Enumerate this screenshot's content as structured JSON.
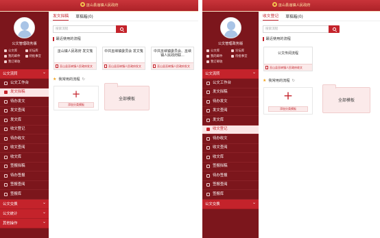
{
  "app_title": "巫山县庙镇人民政府",
  "user": {
    "name": "公文管理政务版"
  },
  "quick_links": [
    "公文库",
    "论坛库",
    "我的邮件",
    "待批事宜",
    "我订邮收"
  ],
  "left": {
    "section_main": "公文流转",
    "menu": [
      "公文工作台",
      "发文拟稿",
      "待办发文",
      "发文查阅",
      "发文库",
      "收文登记",
      "待办收文",
      "收文查阅",
      "收文库",
      "签报拟稿",
      "待办签报",
      "签报查阅",
      "签报库"
    ],
    "active_index": 1,
    "bottom_sections": [
      "公文交换",
      "公文统计",
      "其他操作"
    ],
    "tabs": [
      "发文拟稿",
      "草稿箱(0)"
    ],
    "active_tab": 0,
    "search_placeholder": "搜索流程",
    "recent_title": "最近使用的流程",
    "recent_cards": [
      {
        "title": "巫山镇人民政府 发文笺",
        "footer": "巫山县巫峡镇人民政府发文"
      },
      {
        "title": "中共巫峡镇委员会 发文笺",
        "footer": "巫山县巫峡镇人民政府发文"
      },
      {
        "title": "中共巫峡镇委员会、巫峡镇人民政府联...",
        "footer": "巫山县巫峡镇人民政府发文"
      }
    ],
    "freq_title": "我常用的流程",
    "add_label": "添加分类模板",
    "all_label": "全部模板"
  },
  "right": {
    "section_main": "公文流转",
    "menu": [
      "公文工作台",
      "发文拟稿",
      "待办发文",
      "发文查阅",
      "发文库",
      "收文登记",
      "待办收文",
      "收文查阅",
      "收文库",
      "签报拟稿",
      "待办签报",
      "签报查阅",
      "签报库"
    ],
    "active_index": 5,
    "bottom_sections": [
      "公文交换"
    ],
    "tabs": [
      "收文登记",
      "草稿箱(0)"
    ],
    "active_tab": 0,
    "search_placeholder": "搜索流程",
    "recent_title": "最近使用的流程",
    "recent_cards": [
      {
        "title": "公文传阅流程",
        "footer": "巫山县巫峡镇人民政府收文"
      }
    ],
    "freq_title": "我常用的流程",
    "add_label": "添加分类模板",
    "all_label": "全部模板"
  },
  "colors": {
    "brand": "#c4232b",
    "sidebar": "#7c161c",
    "active_bg": "#fbe6e6"
  }
}
